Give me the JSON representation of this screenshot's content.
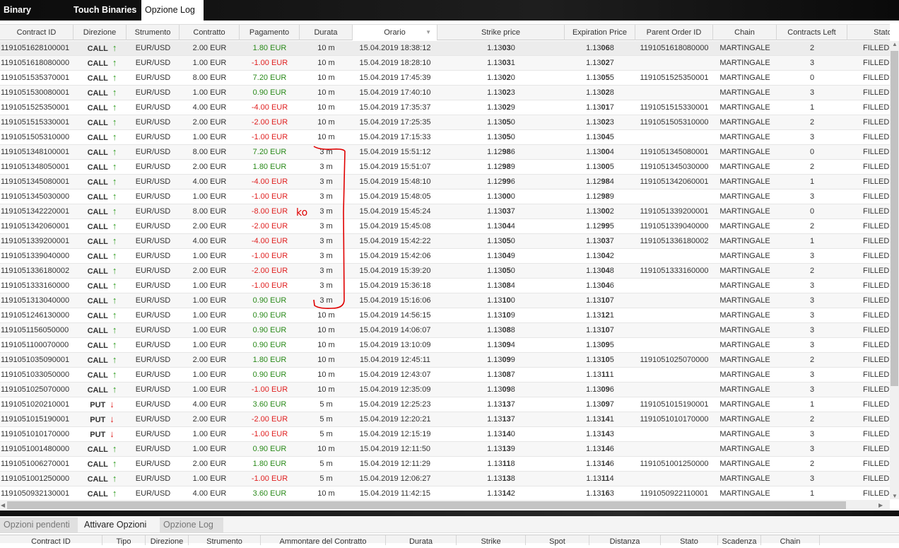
{
  "top_tabs": [
    {
      "label": "Binary Options",
      "active": false
    },
    {
      "label": "Touch Binaries",
      "active": false
    },
    {
      "label": "Opzione Log",
      "active": true
    }
  ],
  "columns": [
    "Contract ID",
    "Direzione",
    "Strumento",
    "Contratto",
    "Pagamento",
    "Durata",
    "Orario",
    "Strike price",
    "Expiration Price",
    "Parent Order ID",
    "Chain",
    "Contracts Left",
    "Stato"
  ],
  "sorted_column": "Orario",
  "colors": {
    "positive": "#2a8a1a",
    "negative": "#e02020",
    "call_arrow": "#2a9a1a",
    "put_arrow": "#e02020",
    "annotation": "#e00000"
  },
  "rows": [
    [
      "1191051628100001",
      "CALL",
      "EUR/USD",
      "2.00 EUR",
      "1.80 EUR",
      "10 m",
      "15.04.2019 18:38:12",
      "1.13030",
      "1.13068",
      "1191051618080000",
      "MARTINGALE",
      "2",
      "FILLED"
    ],
    [
      "1191051618080000",
      "CALL",
      "EUR/USD",
      "1.00 EUR",
      "-1.00 EUR",
      "10 m",
      "15.04.2019 18:28:10",
      "1.13031",
      "1.13027",
      "",
      "MARTINGALE",
      "3",
      "FILLED"
    ],
    [
      "1191051535370001",
      "CALL",
      "EUR/USD",
      "8.00 EUR",
      "7.20 EUR",
      "10 m",
      "15.04.2019 17:45:39",
      "1.13020",
      "1.13055",
      "1191051525350001",
      "MARTINGALE",
      "0",
      "FILLED"
    ],
    [
      "1191051530080001",
      "CALL",
      "EUR/USD",
      "1.00 EUR",
      "0.90 EUR",
      "10 m",
      "15.04.2019 17:40:10",
      "1.13023",
      "1.13028",
      "",
      "MARTINGALE",
      "3",
      "FILLED"
    ],
    [
      "1191051525350001",
      "CALL",
      "EUR/USD",
      "4.00 EUR",
      "-4.00 EUR",
      "10 m",
      "15.04.2019 17:35:37",
      "1.13029",
      "1.13017",
      "1191051515330001",
      "MARTINGALE",
      "1",
      "FILLED"
    ],
    [
      "1191051515330001",
      "CALL",
      "EUR/USD",
      "2.00 EUR",
      "-2.00 EUR",
      "10 m",
      "15.04.2019 17:25:35",
      "1.13050",
      "1.13023",
      "1191051505310000",
      "MARTINGALE",
      "2",
      "FILLED"
    ],
    [
      "1191051505310000",
      "CALL",
      "EUR/USD",
      "1.00 EUR",
      "-1.00 EUR",
      "10 m",
      "15.04.2019 17:15:33",
      "1.13050",
      "1.13045",
      "",
      "MARTINGALE",
      "3",
      "FILLED"
    ],
    [
      "1191051348100001",
      "CALL",
      "EUR/USD",
      "8.00 EUR",
      "7.20 EUR",
      "3 m",
      "15.04.2019 15:51:12",
      "1.12986",
      "1.13004",
      "1191051345080001",
      "MARTINGALE",
      "0",
      "FILLED"
    ],
    [
      "1191051348050001",
      "CALL",
      "EUR/USD",
      "2.00 EUR",
      "1.80 EUR",
      "3 m",
      "15.04.2019 15:51:07",
      "1.12989",
      "1.13005",
      "1191051345030000",
      "MARTINGALE",
      "2",
      "FILLED"
    ],
    [
      "1191051345080001",
      "CALL",
      "EUR/USD",
      "4.00 EUR",
      "-4.00 EUR",
      "3 m",
      "15.04.2019 15:48:10",
      "1.12996",
      "1.12984",
      "1191051342060001",
      "MARTINGALE",
      "1",
      "FILLED"
    ],
    [
      "1191051345030000",
      "CALL",
      "EUR/USD",
      "1.00 EUR",
      "-1.00 EUR",
      "3 m",
      "15.04.2019 15:48:05",
      "1.13000",
      "1.12989",
      "",
      "MARTINGALE",
      "3",
      "FILLED"
    ],
    [
      "1191051342220001",
      "CALL",
      "EUR/USD",
      "8.00 EUR",
      "-8.00 EUR",
      "3 m",
      "15.04.2019 15:45:24",
      "1.13037",
      "1.13002",
      "1191051339200001",
      "MARTINGALE",
      "0",
      "FILLED"
    ],
    [
      "1191051342060001",
      "CALL",
      "EUR/USD",
      "2.00 EUR",
      "-2.00 EUR",
      "3 m",
      "15.04.2019 15:45:08",
      "1.13044",
      "1.12995",
      "1191051339040000",
      "MARTINGALE",
      "2",
      "FILLED"
    ],
    [
      "1191051339200001",
      "CALL",
      "EUR/USD",
      "4.00 EUR",
      "-4.00 EUR",
      "3 m",
      "15.04.2019 15:42:22",
      "1.13050",
      "1.13037",
      "1191051336180002",
      "MARTINGALE",
      "1",
      "FILLED"
    ],
    [
      "1191051339040000",
      "CALL",
      "EUR/USD",
      "1.00 EUR",
      "-1.00 EUR",
      "3 m",
      "15.04.2019 15:42:06",
      "1.13049",
      "1.13042",
      "",
      "MARTINGALE",
      "3",
      "FILLED"
    ],
    [
      "1191051336180002",
      "CALL",
      "EUR/USD",
      "2.00 EUR",
      "-2.00 EUR",
      "3 m",
      "15.04.2019 15:39:20",
      "1.13050",
      "1.13048",
      "1191051333160000",
      "MARTINGALE",
      "2",
      "FILLED"
    ],
    [
      "1191051333160000",
      "CALL",
      "EUR/USD",
      "1.00 EUR",
      "-1.00 EUR",
      "3 m",
      "15.04.2019 15:36:18",
      "1.13084",
      "1.13046",
      "",
      "MARTINGALE",
      "3",
      "FILLED"
    ],
    [
      "1191051313040000",
      "CALL",
      "EUR/USD",
      "1.00 EUR",
      "0.90 EUR",
      "3 m",
      "15.04.2019 15:16:06",
      "1.13100",
      "1.13107",
      "",
      "MARTINGALE",
      "3",
      "FILLED"
    ],
    [
      "1191051246130000",
      "CALL",
      "EUR/USD",
      "1.00 EUR",
      "0.90 EUR",
      "10 m",
      "15.04.2019 14:56:15",
      "1.13109",
      "1.13121",
      "",
      "MARTINGALE",
      "3",
      "FILLED"
    ],
    [
      "1191051156050000",
      "CALL",
      "EUR/USD",
      "1.00 EUR",
      "0.90 EUR",
      "10 m",
      "15.04.2019 14:06:07",
      "1.13088",
      "1.13107",
      "",
      "MARTINGALE",
      "3",
      "FILLED"
    ],
    [
      "1191051100070000",
      "CALL",
      "EUR/USD",
      "1.00 EUR",
      "0.90 EUR",
      "10 m",
      "15.04.2019 13:10:09",
      "1.13094",
      "1.13095",
      "",
      "MARTINGALE",
      "3",
      "FILLED"
    ],
    [
      "1191051035090001",
      "CALL",
      "EUR/USD",
      "2.00 EUR",
      "1.80 EUR",
      "10 m",
      "15.04.2019 12:45:11",
      "1.13099",
      "1.13105",
      "1191051025070000",
      "MARTINGALE",
      "2",
      "FILLED"
    ],
    [
      "1191051033050000",
      "CALL",
      "EUR/USD",
      "1.00 EUR",
      "0.90 EUR",
      "10 m",
      "15.04.2019 12:43:07",
      "1.13087",
      "1.13111",
      "",
      "MARTINGALE",
      "3",
      "FILLED"
    ],
    [
      "1191051025070000",
      "CALL",
      "EUR/USD",
      "1.00 EUR",
      "-1.00 EUR",
      "10 m",
      "15.04.2019 12:35:09",
      "1.13098",
      "1.13096",
      "",
      "MARTINGALE",
      "3",
      "FILLED"
    ],
    [
      "1191051020210001",
      "PUT",
      "EUR/USD",
      "4.00 EUR",
      "3.60 EUR",
      "5 m",
      "15.04.2019 12:25:23",
      "1.13137",
      "1.13097",
      "1191051015190001",
      "MARTINGALE",
      "1",
      "FILLED"
    ],
    [
      "1191051015190001",
      "PUT",
      "EUR/USD",
      "2.00 EUR",
      "-2.00 EUR",
      "5 m",
      "15.04.2019 12:20:21",
      "1.13137",
      "1.13141",
      "1191051010170000",
      "MARTINGALE",
      "2",
      "FILLED"
    ],
    [
      "1191051010170000",
      "PUT",
      "EUR/USD",
      "1.00 EUR",
      "-1.00 EUR",
      "5 m",
      "15.04.2019 12:15:19",
      "1.13140",
      "1.13143",
      "",
      "MARTINGALE",
      "3",
      "FILLED"
    ],
    [
      "1191051001480000",
      "CALL",
      "EUR/USD",
      "1.00 EUR",
      "0.90 EUR",
      "10 m",
      "15.04.2019 12:11:50",
      "1.13139",
      "1.13146",
      "",
      "MARTINGALE",
      "3",
      "FILLED"
    ],
    [
      "1191051006270001",
      "CALL",
      "EUR/USD",
      "2.00 EUR",
      "1.80 EUR",
      "5 m",
      "15.04.2019 12:11:29",
      "1.13118",
      "1.13146",
      "1191051001250000",
      "MARTINGALE",
      "2",
      "FILLED"
    ],
    [
      "1191051001250000",
      "CALL",
      "EUR/USD",
      "1.00 EUR",
      "-1.00 EUR",
      "5 m",
      "15.04.2019 12:06:27",
      "1.13138",
      "1.13114",
      "",
      "MARTINGALE",
      "3",
      "FILLED"
    ],
    [
      "1191050932130001",
      "CALL",
      "EUR/USD",
      "4.00 EUR",
      "3.60 EUR",
      "10 m",
      "15.04.2019 11:42:15",
      "1.13142",
      "1.13163",
      "1191050922110001",
      "MARTINGALE",
      "1",
      "FILLED"
    ]
  ],
  "annotation": {
    "text": "ko"
  },
  "bottom_tabs": [
    {
      "label": "Opzioni pendenti",
      "active": false
    },
    {
      "label": "Attivare Opzioni",
      "active": true
    },
    {
      "label": "Opzione Log",
      "active": false
    }
  ],
  "bottom_columns": [
    "Contract ID",
    "Tipo",
    "Direzione",
    "Strumento",
    "Ammontare del Contratto",
    "Durata",
    "Strike",
    "Spot",
    "Distanza",
    "Stato",
    "Scadenza",
    "Chain"
  ]
}
